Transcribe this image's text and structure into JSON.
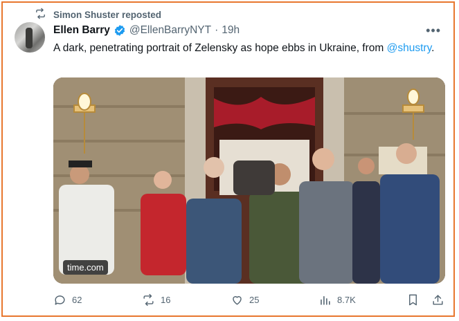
{
  "repost": {
    "text": "Simon Shuster reposted",
    "icon": "repost-icon"
  },
  "author": {
    "name": "Ellen Barry",
    "handle": "@EllenBarryNYT",
    "separator": "·",
    "time": "19h",
    "verified_color": "#1d9bf0"
  },
  "more_label": "•••",
  "tweet": {
    "text_before": "A dark, penetrating portrait of Zelensky as hope ebbs in Ukraine, from ",
    "mention": "@shustry",
    "text_after": "."
  },
  "media": {
    "source_label": "time.com"
  },
  "actions": {
    "replies": "62",
    "reposts": "16",
    "likes": "25",
    "views": "8.7K"
  },
  "colors": {
    "accent": "#1d9bf0",
    "muted": "#536471",
    "frame": "#e8762d"
  }
}
